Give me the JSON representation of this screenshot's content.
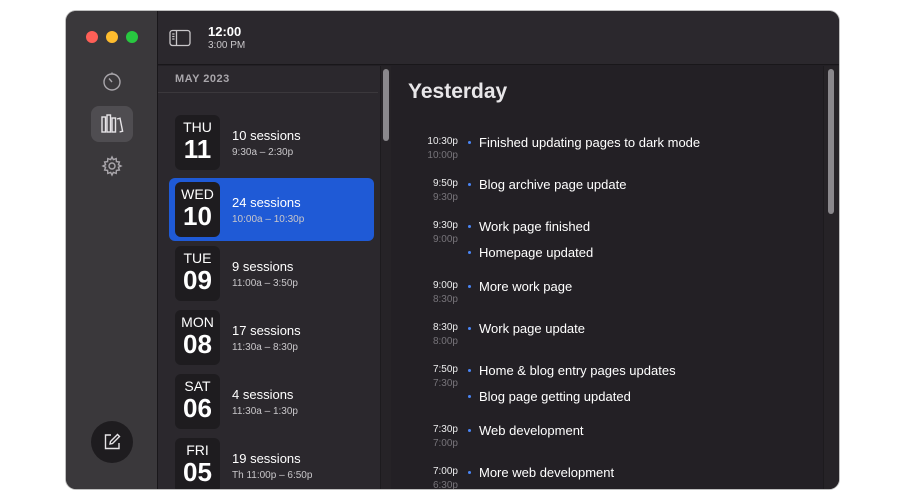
{
  "titlebar": {
    "time": "12:00",
    "subtime": "3:00 PM"
  },
  "sidebar": {
    "icons": [
      "timer-icon",
      "library-icon",
      "gear-icon"
    ],
    "compose": "compose-icon"
  },
  "daylist": {
    "month": "MAY 2023",
    "days": [
      {
        "dow": "THU",
        "num": "11",
        "sessions": "10 sessions",
        "range": "9:30a – 2:30p",
        "selected": false
      },
      {
        "dow": "WED",
        "num": "10",
        "sessions": "24 sessions",
        "range": "10:00a – 10:30p",
        "selected": true
      },
      {
        "dow": "TUE",
        "num": "09",
        "sessions": "9 sessions",
        "range": "11:00a – 3:50p",
        "selected": false
      },
      {
        "dow": "MON",
        "num": "08",
        "sessions": "17 sessions",
        "range": "11:30a – 8:30p",
        "selected": false
      },
      {
        "dow": "SAT",
        "num": "06",
        "sessions": "4 sessions",
        "range": "11:30a – 1:30p",
        "selected": false
      },
      {
        "dow": "FRI",
        "num": "05",
        "sessions": "19 sessions",
        "range": "Th 11:00p – 6:50p",
        "selected": false
      }
    ]
  },
  "main": {
    "title": "Yesterday",
    "entries": [
      {
        "start": "10:30p",
        "end": "10:00p",
        "items": [
          "Finished updating pages to dark mode"
        ]
      },
      {
        "start": "9:50p",
        "end": "9:30p",
        "items": [
          "Blog archive page update"
        ]
      },
      {
        "start": "9:30p",
        "end": "9:00p",
        "items": [
          "Work page finished",
          "Homepage updated"
        ]
      },
      {
        "start": "9:00p",
        "end": "8:30p",
        "items": [
          "More work page"
        ]
      },
      {
        "start": "8:30p",
        "end": "8:00p",
        "items": [
          "Work page update"
        ]
      },
      {
        "start": "7:50p",
        "end": "7:30p",
        "items": [
          "Home & blog entry pages updates",
          "Blog page getting updated"
        ]
      },
      {
        "start": "7:30p",
        "end": "7:00p",
        "items": [
          "Web development"
        ]
      },
      {
        "start": "7:00p",
        "end": "6:30p",
        "items": [
          "More web development"
        ]
      }
    ]
  },
  "colors": {
    "selection": "#1f5ad6",
    "bullet": "#4a86f7",
    "window": "#232025"
  }
}
